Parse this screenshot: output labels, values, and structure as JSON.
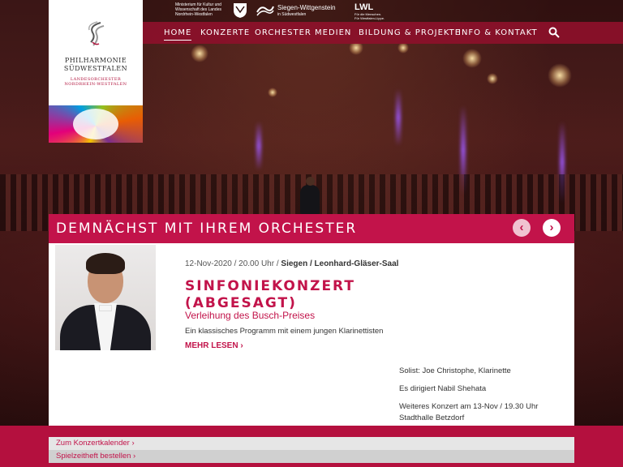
{
  "sponsors": {
    "ministry": "Ministerium für Kultur und Wissenschaft des Landes Nordrhein-Westfalen",
    "siegen_name": "Siegen-Wittgenstein",
    "siegen_sub": "in Südwestfalen",
    "lwl_name": "LWL",
    "lwl_sub": "Für die Menschen. Für Westfalen-Lippe."
  },
  "logo": {
    "name_line1": "PHILHARMONIE",
    "name_line2": "SÜDWESTFALEN",
    "sub_line1": "LANDESORCHESTER",
    "sub_line2": "NORDRHEIN-WESTFALEN"
  },
  "nav": {
    "items": [
      "HOME",
      "KONZERTE",
      "ORCHESTER",
      "MEDIEN",
      "BILDUNG & PROJEKTE",
      "INFO & KONTAKT"
    ],
    "active": "HOME",
    "search_icon": "search-icon"
  },
  "section": {
    "title": "DEMNÄCHST MIT IHREM ORCHESTER",
    "prev_icon": "‹",
    "next_icon": "›"
  },
  "event": {
    "date_time": "12-Nov-2020 / 20.00 Uhr / ",
    "location": "Siegen / Leonhard-Gläser-Saal",
    "title_line1": "SINFONIEKONZERT",
    "title_line2": "(ABGESAGT)",
    "subtitle": "Verleihung des Busch-Preises",
    "description": "Ein klassisches Programm mit einem jungen Klarinettisten",
    "read_more": "MEHR LESEN ›",
    "soloist": "Solist: Joe Christophe, Klarinette",
    "conductor": "Es dirigiert Nabil Shehata",
    "further_line1": "Weiteres Konzert am 13-Nov / 19.30 Uhr",
    "further_line2": "Stadthalle Betzdorf"
  },
  "footer": {
    "calendar_link": "Zum Konzertkalender ›",
    "order_link": "Spielzeitheft bestellen ›"
  },
  "colors": {
    "brand": "#c2134a",
    "nav_bg": "#8c102a",
    "white": "#ffffff"
  }
}
